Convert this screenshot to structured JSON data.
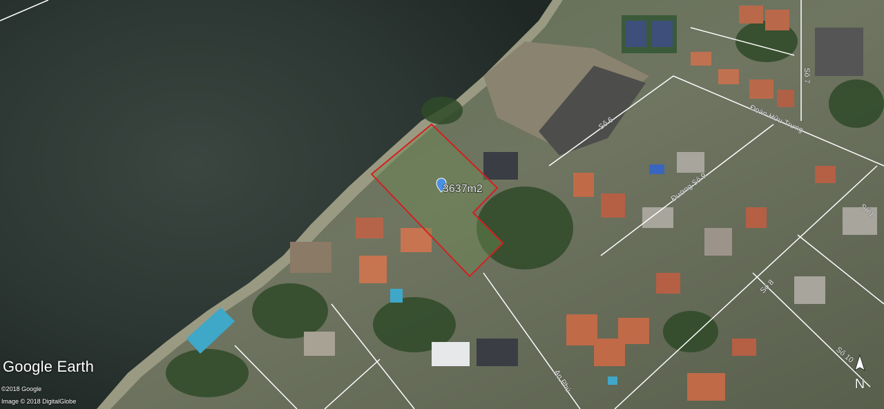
{
  "map": {
    "area_label": "3637m2",
    "streets": [
      "Đoàn Hữu Trưng",
      "Số 6",
      "Đường Số 9",
      "Số 8",
      "An Phú",
      "Số 7",
      "Số 10",
      "Số 1",
      "Số 9"
    ],
    "boundary_color": "#d42020",
    "road_color": "#ffffff",
    "marker_color": "#4a90e2"
  },
  "branding": {
    "brand": "Google Earth",
    "copyright_google": "©2018 Google",
    "copyright_imagery": "Image © 2018 DigitalGlobe",
    "compass_label": "N"
  }
}
